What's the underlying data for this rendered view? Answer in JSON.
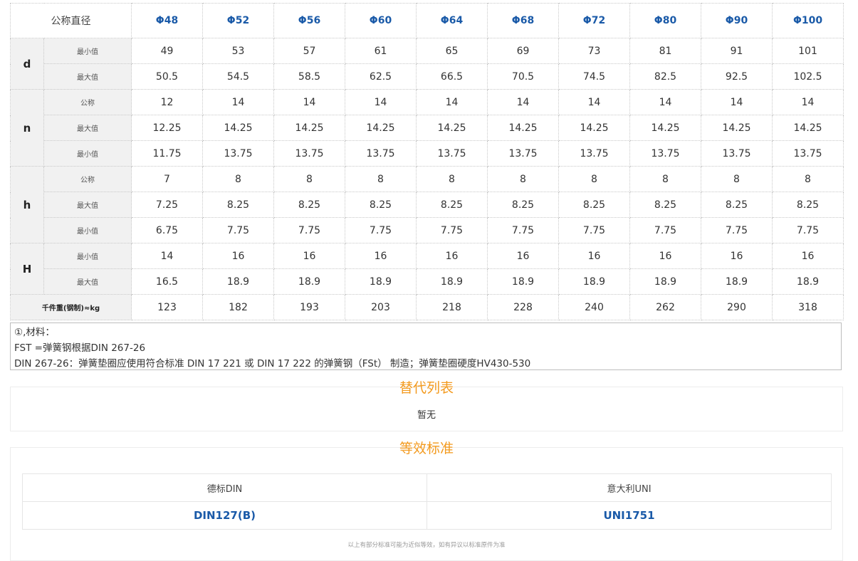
{
  "table": {
    "corner": "公称直径",
    "columns": [
      "Φ48",
      "Φ52",
      "Φ56",
      "Φ60",
      "Φ64",
      "Φ68",
      "Φ72",
      "Φ80",
      "Φ90",
      "Φ100"
    ],
    "groups": [
      {
        "label": "d",
        "rows": [
          {
            "sub": "最小值",
            "values": [
              "49",
              "53",
              "57",
              "61",
              "65",
              "69",
              "73",
              "81",
              "91",
              "101"
            ]
          },
          {
            "sub": "最大值",
            "values": [
              "50.5",
              "54.5",
              "58.5",
              "62.5",
              "66.5",
              "70.5",
              "74.5",
              "82.5",
              "92.5",
              "102.5"
            ]
          }
        ]
      },
      {
        "label": "n",
        "rows": [
          {
            "sub": "公称",
            "values": [
              "12",
              "14",
              "14",
              "14",
              "14",
              "14",
              "14",
              "14",
              "14",
              "14"
            ]
          },
          {
            "sub": "最大值",
            "values": [
              "12.25",
              "14.25",
              "14.25",
              "14.25",
              "14.25",
              "14.25",
              "14.25",
              "14.25",
              "14.25",
              "14.25"
            ]
          },
          {
            "sub": "最小值",
            "values": [
              "11.75",
              "13.75",
              "13.75",
              "13.75",
              "13.75",
              "13.75",
              "13.75",
              "13.75",
              "13.75",
              "13.75"
            ]
          }
        ]
      },
      {
        "label": "h",
        "rows": [
          {
            "sub": "公称",
            "values": [
              "7",
              "8",
              "8",
              "8",
              "8",
              "8",
              "8",
              "8",
              "8",
              "8"
            ]
          },
          {
            "sub": "最大值",
            "values": [
              "7.25",
              "8.25",
              "8.25",
              "8.25",
              "8.25",
              "8.25",
              "8.25",
              "8.25",
              "8.25",
              "8.25"
            ]
          },
          {
            "sub": "最小值",
            "values": [
              "6.75",
              "7.75",
              "7.75",
              "7.75",
              "7.75",
              "7.75",
              "7.75",
              "7.75",
              "7.75",
              "7.75"
            ]
          }
        ]
      },
      {
        "label": "H",
        "rows": [
          {
            "sub": "最小值",
            "values": [
              "14",
              "16",
              "16",
              "16",
              "16",
              "16",
              "16",
              "16",
              "16",
              "16"
            ]
          },
          {
            "sub": "最大值",
            "values": [
              "16.5",
              "18.9",
              "18.9",
              "18.9",
              "18.9",
              "18.9",
              "18.9",
              "18.9",
              "18.9",
              "18.9"
            ]
          }
        ]
      }
    ],
    "weight": {
      "label": "千件重(钢制)≈kg",
      "values": [
        "123",
        "182",
        "193",
        "203",
        "218",
        "228",
        "240",
        "262",
        "290",
        "318"
      ]
    }
  },
  "notes": [
    "①,材料：",
    "FST =弹簧钢根据DIN 267-26",
    "DIN 267-26：弹簧垫圈应使用符合标准 DIN 17 221 或 DIN 17 222 的弹簧钢（FSt） 制造；弹簧垫圈硬度HV430-530"
  ],
  "alternatives": {
    "title": "替代列表",
    "body": "暂无"
  },
  "equivalents": {
    "title": "等效标准",
    "headers": [
      "德标DIN",
      "意大利UNI"
    ],
    "values": [
      "DIN127(B)",
      "UNI1751"
    ],
    "disclaimer": "以上有部分标准可能为近似等效，如有异议以标准原件为准"
  }
}
